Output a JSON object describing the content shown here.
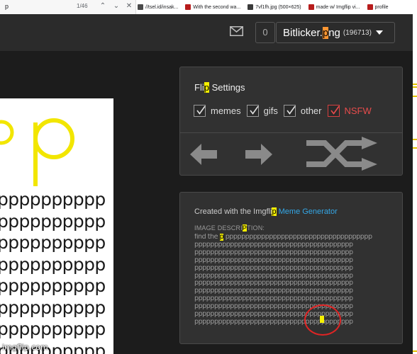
{
  "find_bar": {
    "term": "p",
    "count": "1/46"
  },
  "bookmarks": [
    {
      "label": "//tsel.id/insak...",
      "color": "#4a4a4a"
    },
    {
      "label": "With the second wa...",
      "color": "#b71c1c"
    },
    {
      "label": "7vf1fh.jpg (500×625)",
      "color": "#3a3a3a"
    },
    {
      "label": "made w/ Imgflip vi...",
      "color": "#b71c1c"
    },
    {
      "label": "profile",
      "color": "#b71c1c"
    }
  ],
  "header": {
    "notification_count": "0",
    "username_pre": "Bitlicker.",
    "username_hl": "p",
    "username_post": "ng",
    "points": "(196713)"
  },
  "meme": {
    "row_text": "pppppppppp",
    "watermark": "imgflip.com"
  },
  "flip_settings": {
    "title_pre": "Fli",
    "title_hl": "p",
    "title_post": " Settings",
    "checkboxes": [
      {
        "label": "memes",
        "checked": true
      },
      {
        "label": "gifs",
        "checked": true
      },
      {
        "label": "other",
        "checked": true
      },
      {
        "label": "NSFW",
        "checked": true
      }
    ]
  },
  "meme_info": {
    "created_pre": "Created with the Imgfli",
    "created_hl": "p",
    "generator_link": "Meme Generator",
    "desc_label_pre": "IMAGE DESCRI",
    "desc_label_hl": "P",
    "desc_label_post": "TION:",
    "desc_first_pre": "find the ",
    "desc_first_hl": "p",
    "desc_first_post": " ppppppppppppppppppppppppppppppppppppp",
    "desc_line": "pppppppppppppppppppppppppppppppppppppppp",
    "desc_line_count": 11
  },
  "colors": {
    "highlight": "#f6f000",
    "link": "#34a7e6",
    "nsfw": "#e74c4c",
    "annotation": "#e02424"
  }
}
